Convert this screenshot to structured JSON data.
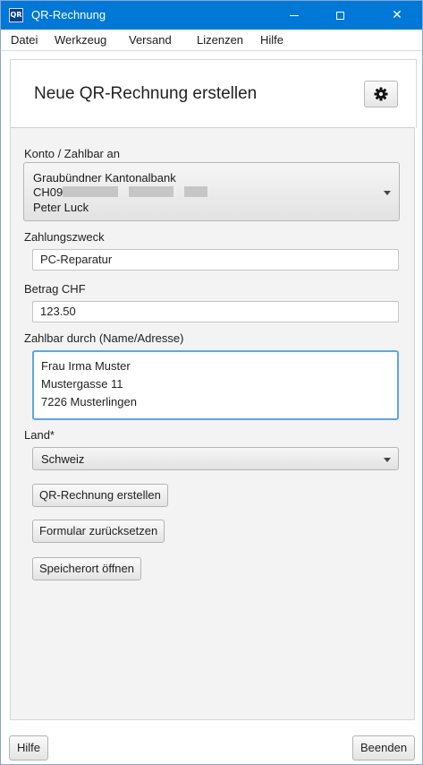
{
  "window": {
    "icon_text": "QR",
    "title": "QR-Rechnung",
    "close_glyph": "✕"
  },
  "menu": [
    "Datei",
    "Werkzeug",
    "Versand",
    "Lizenzen",
    "Hilfe"
  ],
  "header": {
    "title": "Neue QR-Rechnung erstellen",
    "settings_icon": "gear-icon"
  },
  "form": {
    "account": {
      "label": "Konto / Zahlbar an",
      "bank": "Graubündner Kantonalbank",
      "iban_prefix": "CH09",
      "holder": "Peter Luck"
    },
    "purpose": {
      "label": "Zahlungszweck",
      "value": "PC-Reparatur"
    },
    "amount": {
      "label": "Betrag CHF",
      "value": "123.50"
    },
    "payer": {
      "label": "Zahlbar durch (Name/Adresse)",
      "lines": [
        "Frau Irma Muster",
        "Mustergasse 11",
        "7226 Musterlingen"
      ]
    },
    "country": {
      "label": "Land*",
      "value": "Schweiz"
    }
  },
  "actions": {
    "create": "QR-Rechnung erstellen",
    "reset": "Formular zurücksetzen",
    "open_location": "Speicherort öffnen"
  },
  "footer": {
    "help": "Hilfe",
    "quit": "Beenden"
  },
  "colors": {
    "titlebar": "#0078d7",
    "focus_border": "#5aa7e8"
  }
}
